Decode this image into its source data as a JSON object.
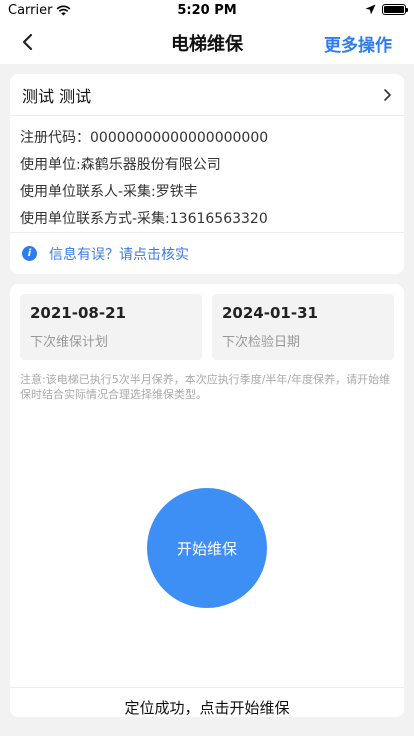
{
  "status_bar": {
    "carrier": "Carrier",
    "time": "5:20 PM"
  },
  "nav": {
    "title": "电梯维保",
    "more_label": "更多操作"
  },
  "info_card": {
    "name": "测试  测试",
    "rows": [
      "注册代码：00000000000000000000",
      "使用单位:森鹤乐器股份有限公司",
      "使用单位联系人-采集:罗铁丰",
      "使用单位联系方式-采集:13616563320"
    ],
    "verify_text": "信息有误？请点击核实"
  },
  "schedule": {
    "next_maintenance_date": "2021-08-21",
    "next_maintenance_label": "下次维保计划",
    "next_inspection_date": "2024-01-31",
    "next_inspection_label": "下次检验日期"
  },
  "notice": "注意:该电梯已执行5次半月保养，本次应执行季度/半年/年度保养，请开始维保时结合实际情况合理选择维保类型。",
  "start_button_label": "开始维保",
  "location_status": "定位成功，点击开始维保",
  "colors": {
    "accent": "#2f7bf0",
    "button": "#3d8ef5",
    "background": "#f2f2f2"
  }
}
